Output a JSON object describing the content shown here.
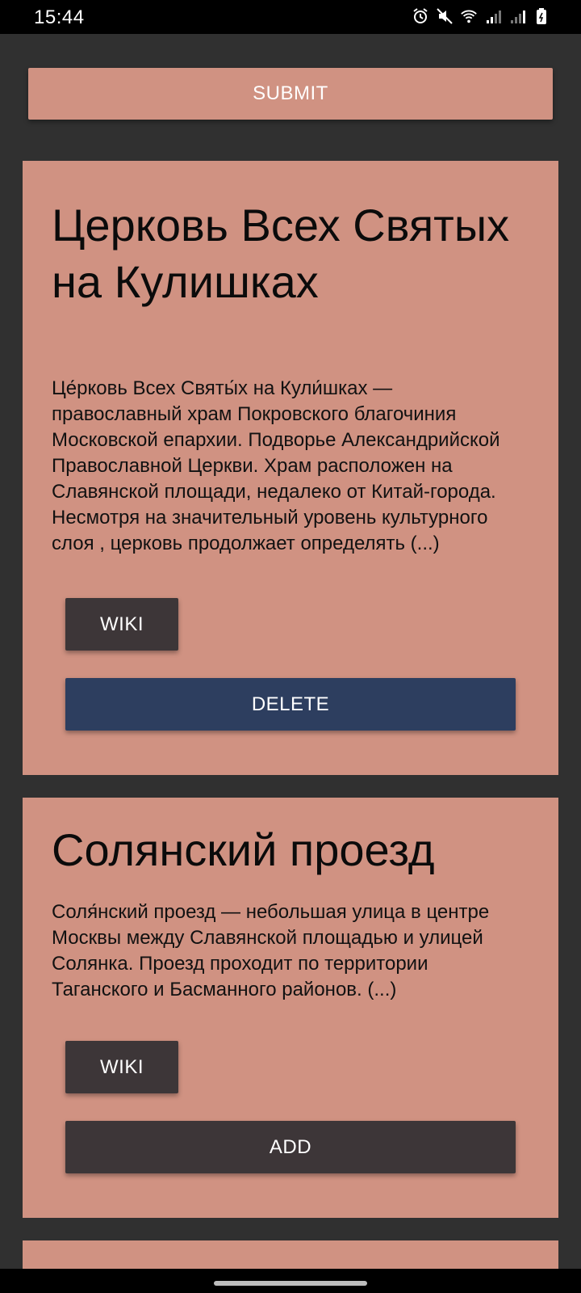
{
  "status_bar": {
    "time": "15:44",
    "icons": [
      "alarm-icon",
      "mute-icon",
      "wifi-icon",
      "signal-icon",
      "signal-icon",
      "battery-icon"
    ]
  },
  "toolbar": {
    "submit_label": "SUBMIT"
  },
  "cards": [
    {
      "title": "Церковь Всех Святых на Кулишках",
      "description": "Це́рковь Всех Святы́х на Кули́шках — православный храм Покровского благочиния Московской епархии. Подворье Александрийской Православной Церкви. Храм расположен на Славянской площади, недалеко от Китай-города. Несмотря на значительный уровень культурного слоя , церковь продолжает определять (...)",
      "wiki_label": "WIKI",
      "action_label": "DELETE"
    },
    {
      "title": "Солянский проезд",
      "description": "Соля́нский проезд — небольшая улица в центре Москвы между Славянской площадью и улицей Солянка. Проезд проходит по территории Таганского и Басманного районов.  (...)",
      "wiki_label": "WIKI",
      "action_label": "ADD"
    }
  ],
  "colors": {
    "background": "#303030",
    "card": "#d09282",
    "dark_button": "#3d3638",
    "delete_button": "#2d3e5f"
  }
}
